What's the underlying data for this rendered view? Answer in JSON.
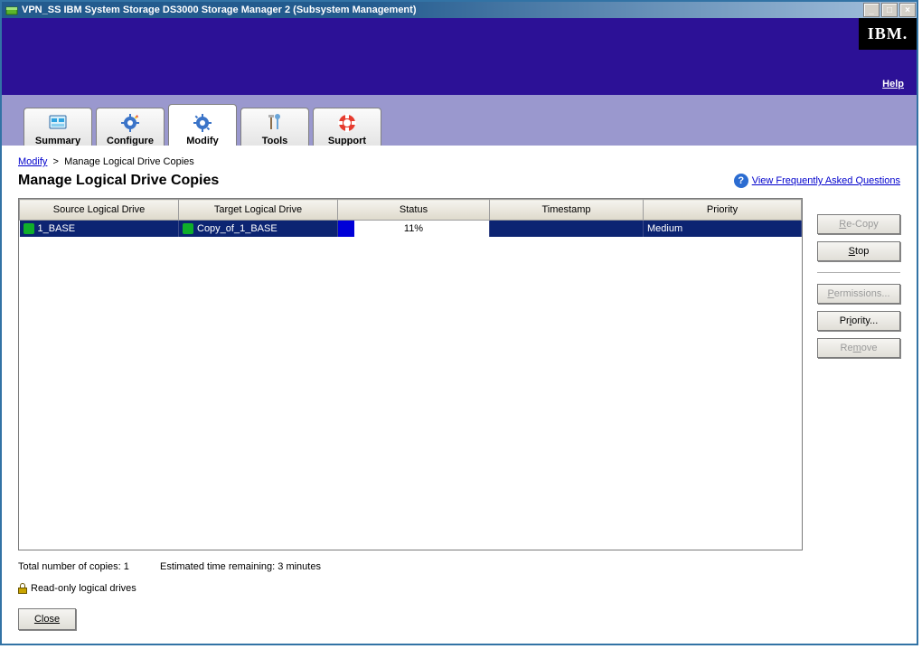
{
  "window": {
    "title": "VPN_SS IBM System Storage DS3000 Storage Manager 2 (Subsystem Management)"
  },
  "brand": {
    "logo_text": "IBM.",
    "help_label": "Help"
  },
  "tabs": [
    {
      "label": "Summary",
      "active": false
    },
    {
      "label": "Configure",
      "active": false
    },
    {
      "label": "Modify",
      "active": true
    },
    {
      "label": "Tools",
      "active": false
    },
    {
      "label": "Support",
      "active": false
    }
  ],
  "breadcrumb": {
    "root_label": "Modify",
    "separator": ">",
    "current": "Manage Logical Drive Copies"
  },
  "page_title": "Manage Logical Drive Copies",
  "faq_link": "View Frequently Asked Questions",
  "table": {
    "headers": {
      "source": "Source Logical Drive",
      "target": "Target Logical Drive",
      "status": "Status",
      "timestamp": "Timestamp",
      "priority": "Priority"
    },
    "rows": [
      {
        "source": "1_BASE",
        "target": "Copy_of_1_BASE",
        "status_percent": 11,
        "status_text": "11%",
        "timestamp": "",
        "priority": "Medium"
      }
    ]
  },
  "buttons": {
    "recopy": "Re-Copy",
    "stop": "Stop",
    "permissions": "Permissions...",
    "priority": "Priority...",
    "remove": "Remove"
  },
  "summary": {
    "total_label": "Total number of copies:",
    "total_value": "1",
    "eta_label": "Estimated time remaining:",
    "eta_value": "3 minutes"
  },
  "readonly_label": "Read-only logical drives",
  "close_label": "Close"
}
